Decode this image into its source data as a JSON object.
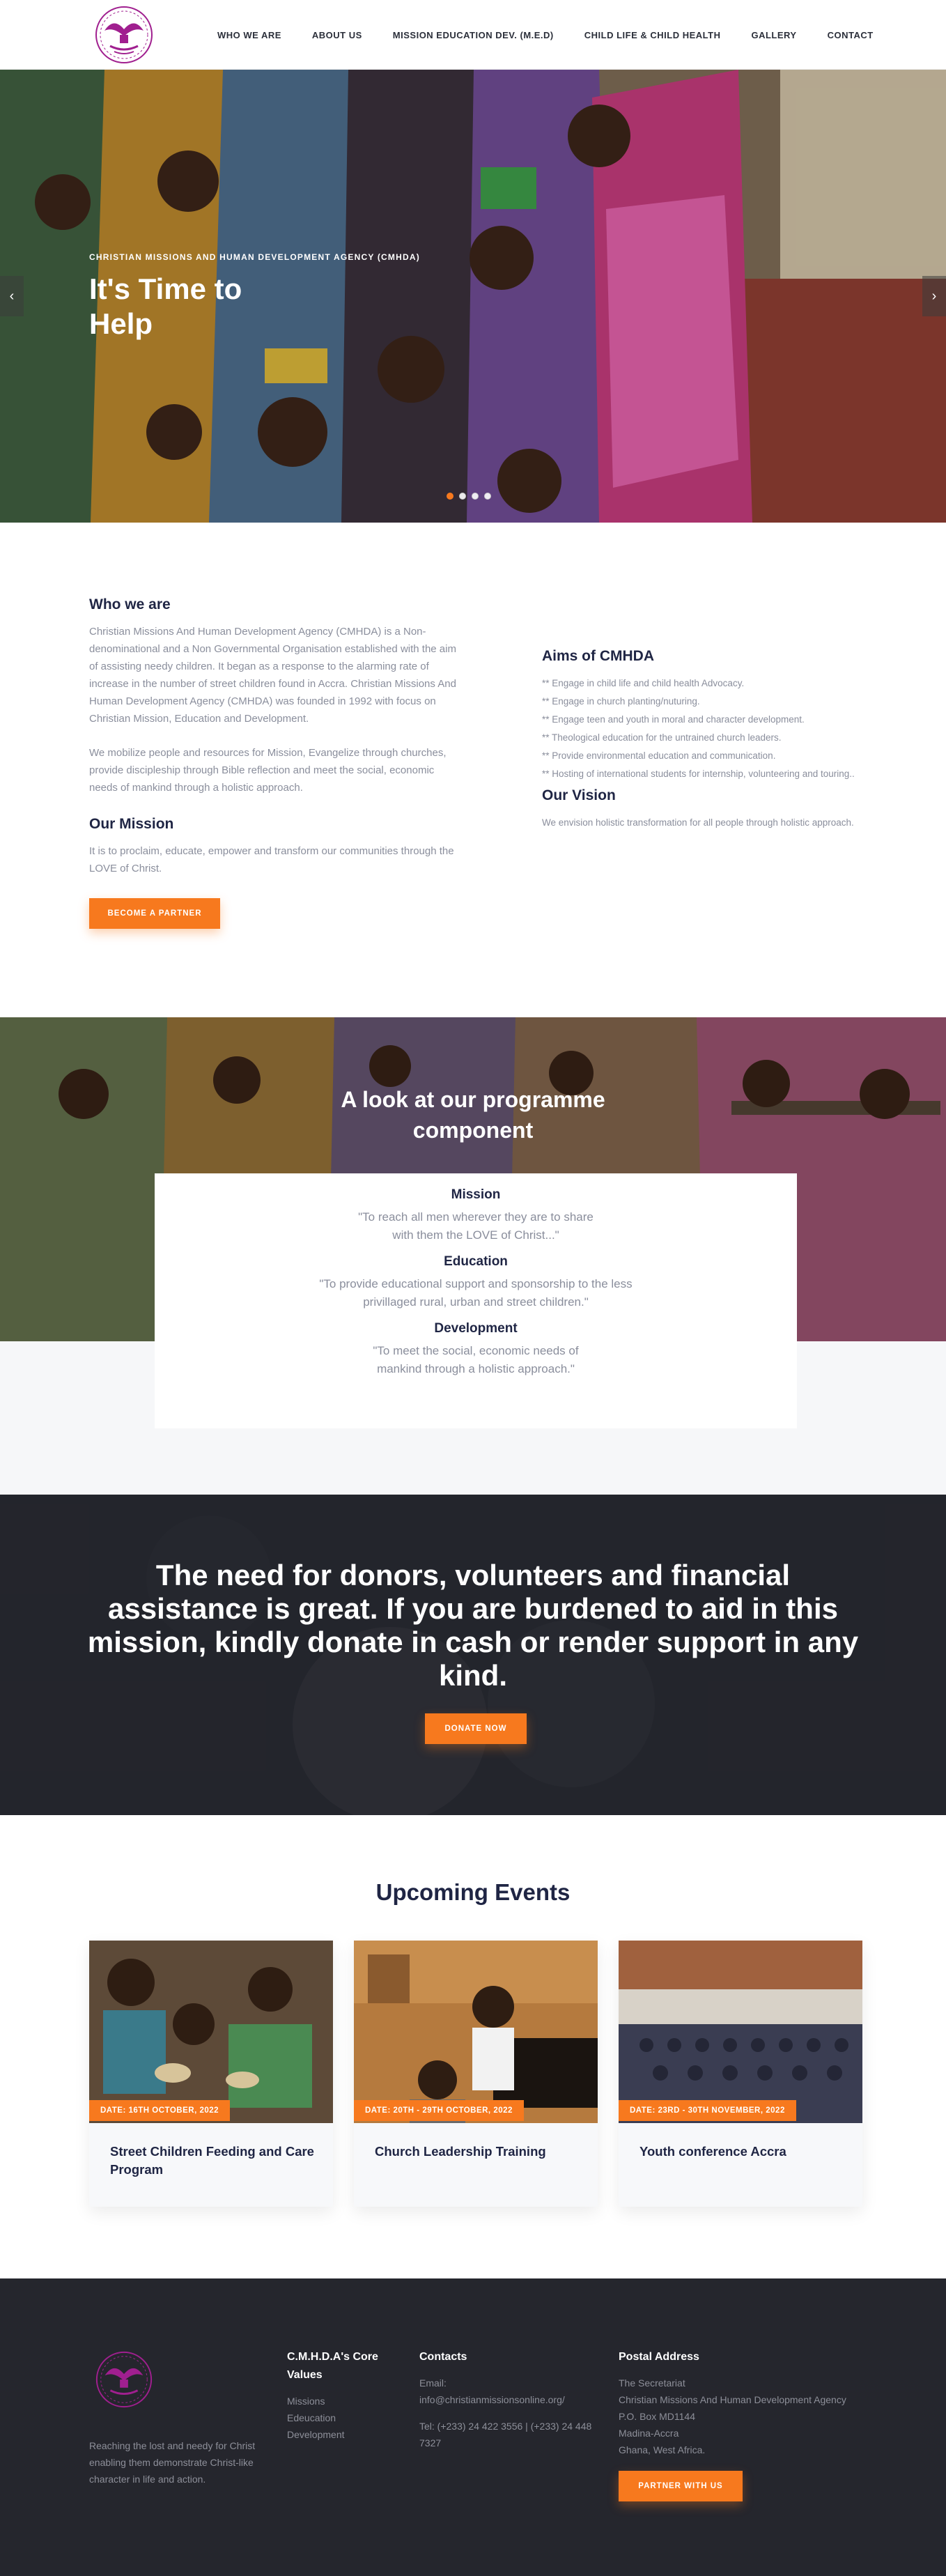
{
  "nav": {
    "items": [
      "WHO WE ARE",
      "ABOUT US",
      "MISSION EDUCATION DEV. (M.E.D)",
      "CHILD LIFE & CHILD HEALTH",
      "GALLERY",
      "CONTACT"
    ]
  },
  "hero": {
    "kicker": "CHRISTIAN MISSIONS AND HUMAN DEVELOPMENT AGENCY (CMHDA)",
    "title": "It's Time to Help",
    "prev_icon": "chevron-left-icon",
    "next_icon": "chevron-right-icon",
    "active_slide": 1,
    "slide_count": 4
  },
  "about": {
    "who_title": "Who we are",
    "who_p1": "Christian Missions And Human Development Agency (CMHDA) is a Non-denominational and a Non Governmental Organisation established with the aim of assisting needy children. It began as a response to the alarming rate of increase in the number of street children found in Accra. Christian Missions And Human Development Agency (CMHDA) was founded in 1992 with focus on Christian Mission, Education and Development.",
    "who_p2": "We mobilize people and resources for Mission, Evangelize through churches, provide discipleship through Bible reflection and meet the social, economic needs of mankind through a holistic approach.",
    "mission_title": "Our Mission",
    "mission_text": "It is to proclaim, educate, empower and transform our communities through the LOVE of Christ.",
    "partner_button": "BECOME A PARTNER",
    "aims_title": "Aims of CMHDA",
    "aims": [
      "** Engage in child life and child health Advocacy.",
      "** Engage in church planting/nuturing.",
      "** Engage teen and youth in moral and character development.",
      "** Theological education for the untrained church leaders.",
      "** Provide environmental education and communication.",
      "** Hosting of international students for internship, volunteering and touring.."
    ],
    "vision_title": "Our Vision",
    "vision_text": "We envision holistic transformation for all people through holistic approach."
  },
  "programme": {
    "title": "A look at our programme component",
    "items": [
      {
        "heading": "Mission",
        "quote": "\"To reach all men wherever they are to share with them the LOVE of Christ...\""
      },
      {
        "heading": "Education",
        "quote": "\"To provide educational support and sponsorship to the less privillaged rural, urban and street children.\""
      },
      {
        "heading": "Development",
        "quote": "\"To meet the social, economic needs of mankind through a holistic approach.\""
      }
    ]
  },
  "donate": {
    "text": "The need for donors, volunteers and financial assistance is great. If you are burdened to aid in this mission, kindly donate in cash or render support in any kind.",
    "button": "DONATE NOW"
  },
  "events": {
    "title": "Upcoming Events",
    "items": [
      {
        "date": "DATE: 16TH OCTOBER, 2022",
        "title": "Street Children Feeding and Care Program"
      },
      {
        "date": "DATE: 20TH - 29TH OCTOBER, 2022",
        "title": "Church Leadership Training"
      },
      {
        "date": "DATE: 23RD - 30TH NOVEMBER, 2022",
        "title": "Youth conference Accra"
      }
    ]
  },
  "footer": {
    "about": "Reaching the lost and needy for Christ enabling them demonstrate Christ-like character in life and action.",
    "values_title": "C.M.H.D.A's Core Values",
    "values": [
      "Missions",
      "Edeucation",
      "Development"
    ],
    "contacts_title": "Contacts",
    "email_label": "Email:",
    "email": "info@christianmissionsonline.org/",
    "tel": "Tel: (+233) 24 422 3556 | (+233) 24 448 7327",
    "postal_title": "Postal Address",
    "postal": [
      "The Secretariat",
      "Christian Missions And Human Development Agency",
      "P.O. Box MD1144",
      "Madina-Accra",
      "Ghana, West Africa."
    ],
    "partner_button": "PARTNER WITH US"
  },
  "colors": {
    "accent": "#f7791e",
    "heading": "#1f2544",
    "footer_bg": "#25262d",
    "logo": "#a01f8f"
  }
}
